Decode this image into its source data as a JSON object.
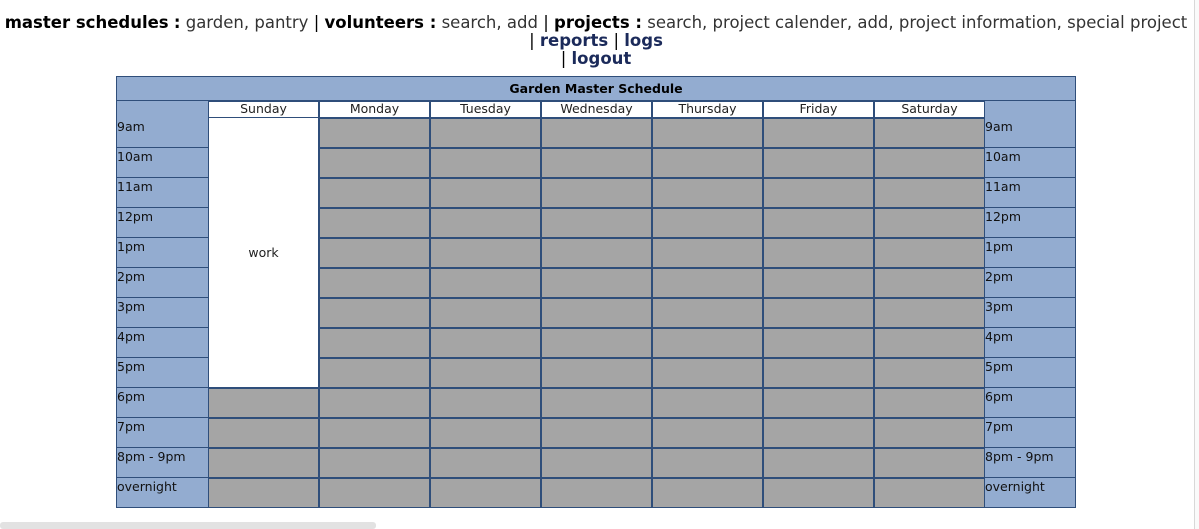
{
  "nav": {
    "master_schedules": {
      "label": "master schedules",
      "links": [
        "garden",
        "pantry"
      ]
    },
    "volunteers": {
      "label": "volunteers",
      "links": [
        "search",
        "add"
      ]
    },
    "projects": {
      "label": "projects",
      "links": [
        "search",
        "project calender",
        "add",
        "project information",
        "special project"
      ]
    },
    "reports": "reports",
    "logs": "logs",
    "logout": "logout"
  },
  "schedule": {
    "title": "Garden Master Schedule",
    "days": [
      "Sunday",
      "Monday",
      "Tuesday",
      "Wednesday",
      "Thursday",
      "Friday",
      "Saturday"
    ],
    "times": [
      "9am",
      "10am",
      "11am",
      "12pm",
      "1pm",
      "2pm",
      "3pm",
      "4pm",
      "5pm",
      "6pm",
      "7pm",
      "8pm - 9pm",
      "overnight"
    ],
    "entries": [
      {
        "day": "Sunday",
        "start": "9am",
        "end": "5pm",
        "label": "work"
      }
    ],
    "colors": {
      "header_bg": "#93acd0",
      "empty_slot": "#a5a5a5",
      "booked_slot": "#ffffff",
      "border": "#2f4e7a"
    }
  }
}
